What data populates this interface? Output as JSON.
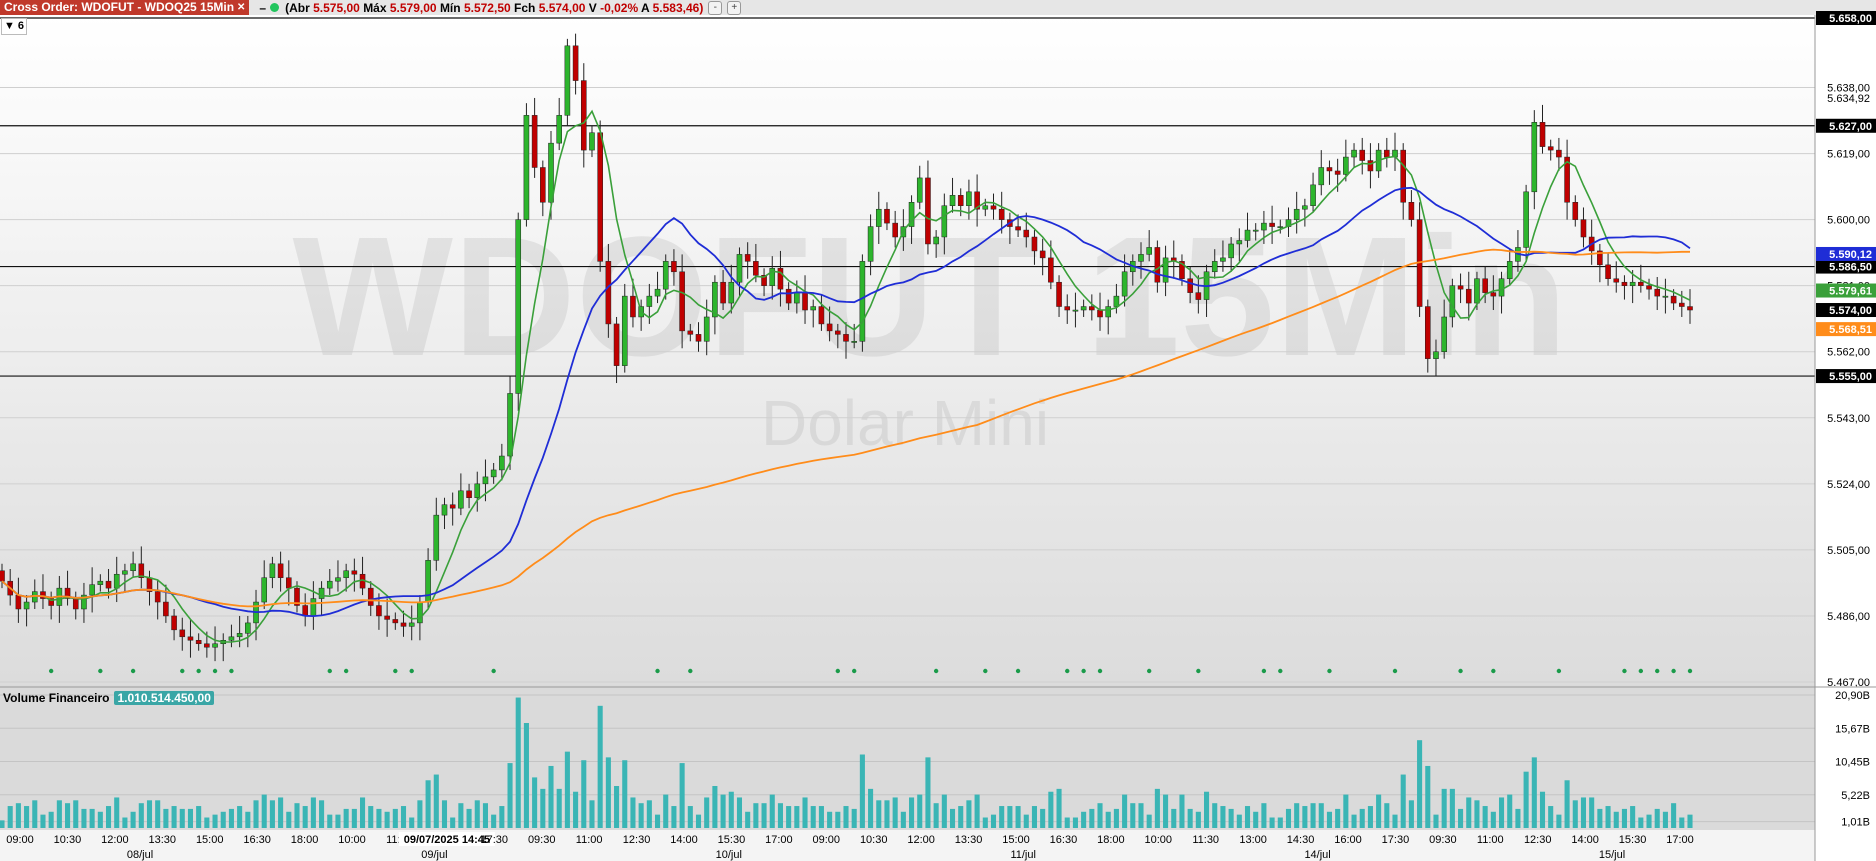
{
  "topbar": {
    "order_label": "Cross Order: WDOFUT - WDOQ25 15Min",
    "order_close": "✕",
    "dash": "–",
    "ohlc_open_label": "(Abr",
    "ohlc_open": "5.575,00",
    "ohlc_high_label": "Máx",
    "ohlc_high": "5.579,00",
    "ohlc_low_label": "Mín",
    "ohlc_low": "5.572,50",
    "ohlc_close_label": "Fch",
    "ohlc_close": "5.574,00",
    "ohlc_var_label": "V",
    "ohlc_var": "-0,02%",
    "ohlc_avg_label": "A",
    "ohlc_avg": "5.583,46)",
    "btn_minus": "-",
    "btn_plus": "+"
  },
  "collapse_label": "▼ 6",
  "watermark": {
    "symbol": "WDOFUT 15Min",
    "name": "Dolar Mini"
  },
  "volume_panel": {
    "label": "Volume Financeiro",
    "value": "1.010.514.450,00"
  },
  "colors": {
    "up": "#2db52d",
    "down": "#c00000",
    "ma_fast": "#3aa03a",
    "ma_mid": "#1f2dd6",
    "ma_slow": "#ff8c1a",
    "volume": "#3ab5b5"
  },
  "chart_data": {
    "type": "candlestick",
    "price_axis": {
      "ticks": [
        "5.638,00",
        "5.619,00",
        "5.600,00",
        "5.581,00",
        "5.562,00",
        "5.543,00",
        "5.524,00",
        "5.505,00",
        "5.486,00",
        "5.467,00"
      ],
      "ylim": [
        5467,
        5658
      ],
      "extra_label": "5.634,92"
    },
    "horizontal_lines": [
      {
        "value": 5658,
        "label": "5.658,00"
      },
      {
        "value": 5627,
        "label": "5.627,00"
      },
      {
        "value": 5586.5,
        "label": "5.586,50"
      },
      {
        "value": 5555,
        "label": "5.555,00"
      }
    ],
    "price_tags": [
      {
        "value": 5590.12,
        "label": "5.590,12",
        "color": "#1f2dd6"
      },
      {
        "value": 5579.61,
        "label": "5.579,61",
        "color": "#3aa03a"
      },
      {
        "value": 5574.0,
        "label": "5.574,00",
        "color": "#000000"
      },
      {
        "value": 5568.51,
        "label": "5.568,51",
        "color": "#ff8c1a"
      }
    ],
    "time_labels": [
      "09:00",
      "10:30",
      "12:00",
      "13:30",
      "15:00",
      "16:30",
      "18:00",
      "10:00",
      "11:30",
      "09/07/2025 14:45",
      "17:30",
      "09:30",
      "11:00",
      "12:30",
      "14:00",
      "15:30",
      "17:00",
      "09:00",
      "10:30",
      "12:00",
      "13:30",
      "15:00",
      "16:30",
      "18:00",
      "10:00",
      "11:30",
      "13:00",
      "14:30",
      "16:00",
      "17:30",
      "09:30",
      "11:00",
      "12:30",
      "14:00",
      "15:30",
      "17:00"
    ],
    "date_labels": [
      "08/jul",
      "09/jul",
      "10/jul",
      "11/jul",
      "14/jul",
      "15/jul"
    ],
    "close_series": [
      5496,
      5492,
      5488,
      5490,
      5493,
      5491,
      5489,
      5494,
      5491,
      5488,
      5492,
      5495,
      5496,
      5494,
      5498,
      5499,
      5501,
      5497,
      5493,
      5490,
      5486,
      5482,
      5480,
      5479,
      5478,
      5477,
      5478,
      5479,
      5480,
      5481,
      5484,
      5490,
      5497,
      5501,
      5497,
      5494,
      5489,
      5486,
      5491,
      5494,
      5496,
      5497,
      5499,
      5498,
      5494,
      5489,
      5486,
      5485,
      5484,
      5483,
      5484,
      5490,
      5502,
      5515,
      5518,
      5517,
      5522,
      5520,
      5524,
      5526,
      5528,
      5532,
      5550,
      5600,
      5630,
      5615,
      5605,
      5622,
      5630,
      5650,
      5640,
      5620,
      5625,
      5588,
      5570,
      5558,
      5578,
      5572,
      5575,
      5578,
      5580,
      5588,
      5585,
      5568,
      5567,
      5565,
      5572,
      5582,
      5576,
      5582,
      5590,
      5588,
      5584,
      5581,
      5586,
      5580,
      5576,
      5579,
      5574,
      5575,
      5570,
      5568,
      5567,
      5565,
      5565,
      5588,
      5598,
      5603,
      5599,
      5595,
      5598,
      5605,
      5612,
      5593,
      5595,
      5604,
      5607,
      5604,
      5608,
      5603,
      5604,
      5603,
      5600,
      5598,
      5597,
      5595,
      5591,
      5589,
      5582,
      5575,
      5574,
      5574,
      5575,
      5574,
      5572,
      5575,
      5578,
      5585,
      5588,
      5590,
      5592,
      5582,
      5589,
      5588,
      5583,
      5579,
      5577,
      5585,
      5588,
      5589,
      5593,
      5594,
      5597,
      5597,
      5599,
      5598,
      5598,
      5600,
      5603,
      5604,
      5610,
      5615,
      5614,
      5613,
      5618,
      5620,
      5617,
      5614,
      5620,
      5618,
      5620,
      5605,
      5600,
      5575,
      5560,
      5562,
      5572,
      5581,
      5580,
      5576,
      5583,
      5579,
      5578,
      5583,
      5588,
      5592,
      5608,
      5628,
      5621,
      5620,
      5618,
      5605,
      5600,
      5595,
      5591,
      5587,
      5583,
      5582,
      5581,
      5582,
      5581,
      5580,
      5578,
      5578,
      5576,
      5575,
      5574
    ],
    "volume_axis": {
      "ticks": [
        "20,90B",
        "15,67B",
        "10,45B",
        "5,22B",
        "1,01B"
      ],
      "ylim": [
        0,
        20.9
      ]
    }
  }
}
